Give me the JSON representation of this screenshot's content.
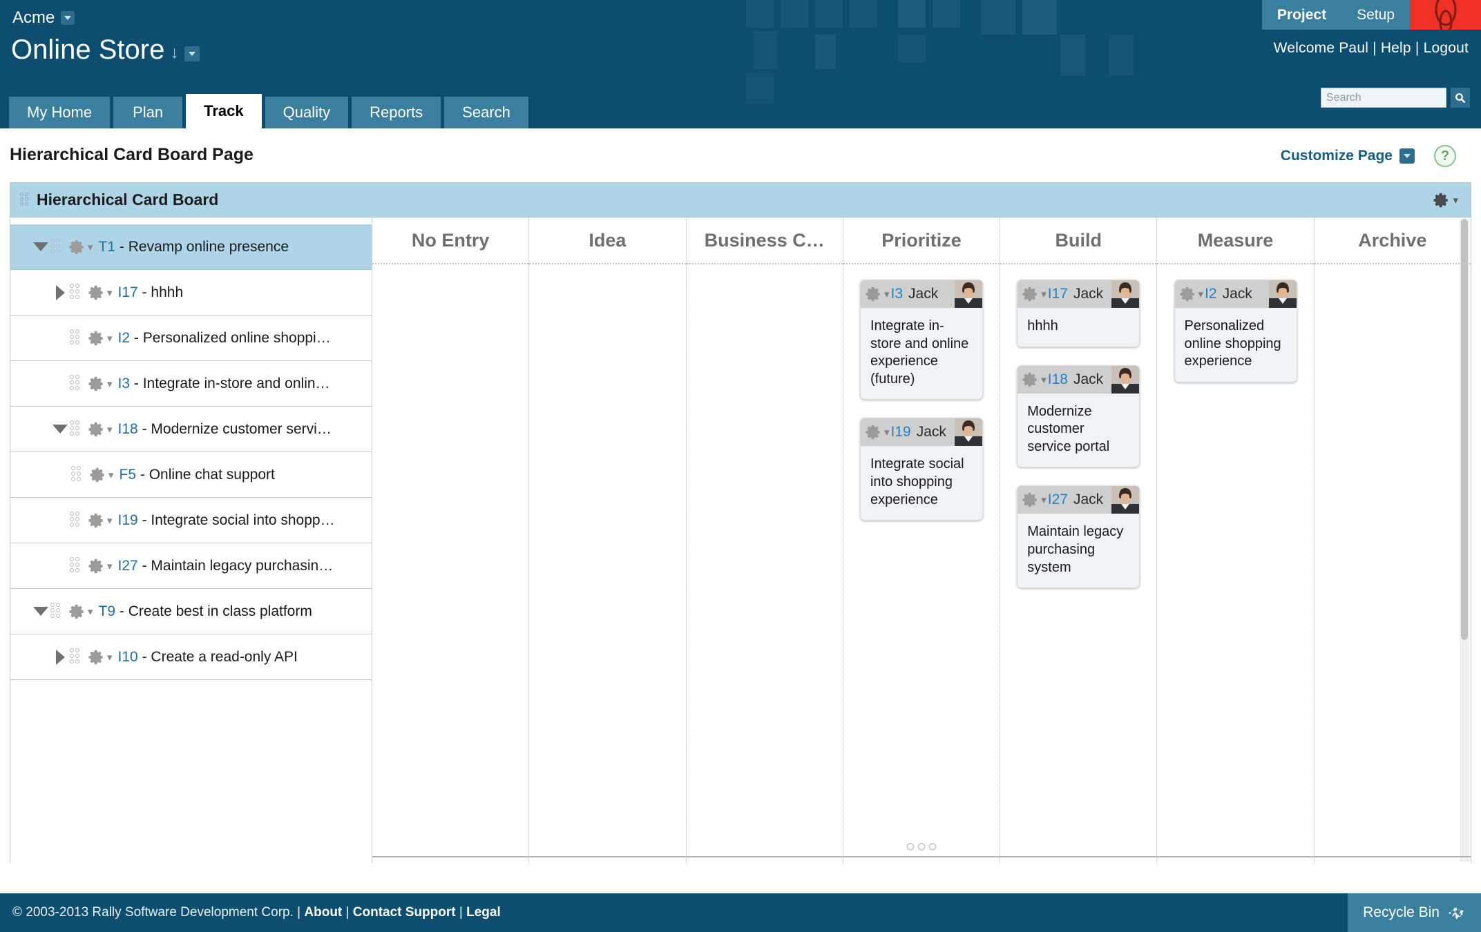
{
  "header": {
    "org": "Acme",
    "project": "Online Store",
    "project_sort_icon": "down-arrow-icon",
    "nav_right": [
      {
        "label": "Project",
        "active": true
      },
      {
        "label": "Setup",
        "active": false
      }
    ],
    "welcome": "Welcome Paul",
    "help_link": "Help",
    "logout_link": "Logout",
    "separator": "|",
    "search_placeholder": "Search",
    "search_value": "",
    "search_icon": "magnifier-icon",
    "tabs": [
      {
        "label": "My Home",
        "active": false
      },
      {
        "label": "Plan",
        "active": false
      },
      {
        "label": "Track",
        "active": true
      },
      {
        "label": "Quality",
        "active": false
      },
      {
        "label": "Reports",
        "active": false
      },
      {
        "label": "Search",
        "active": false
      }
    ]
  },
  "page": {
    "title": "Hierarchical Card Board Page",
    "customize_label": "Customize Page",
    "help_glyph": "?"
  },
  "panel": {
    "title": "Hierarchical Card Board",
    "gear_icon": "gear-icon"
  },
  "tree": {
    "items": [
      {
        "twisty": "open",
        "indent": 0,
        "id": "T1",
        "name": "Revamp online presence",
        "selected": true
      },
      {
        "twisty": "closed",
        "indent": 1,
        "id": "I17",
        "name": "hhhh",
        "selected": false
      },
      {
        "twisty": "none",
        "indent": 1,
        "id": "I2",
        "name": "Personalized online shoppi…",
        "selected": false
      },
      {
        "twisty": "none",
        "indent": 1,
        "id": "I3",
        "name": "Integrate in-store and onlin…",
        "selected": false
      },
      {
        "twisty": "open",
        "indent": 1,
        "id": "I18",
        "name": "Modernize customer servi…",
        "selected": false
      },
      {
        "twisty": "none",
        "indent": 2,
        "id": "F5",
        "name": "Online chat support",
        "selected": false
      },
      {
        "twisty": "none",
        "indent": 1,
        "id": "I19",
        "name": "Integrate social into shopp…",
        "selected": false
      },
      {
        "twisty": "none",
        "indent": 1,
        "id": "I27",
        "name": "Maintain legacy purchasin…",
        "selected": false
      },
      {
        "twisty": "open",
        "indent": 0,
        "id": "T9",
        "name": "Create best in class platform",
        "selected": false
      },
      {
        "twisty": "closed",
        "indent": 1,
        "id": "I10",
        "name": "Create a read-only API",
        "selected": false
      }
    ],
    "separator": " - "
  },
  "board": {
    "columns": [
      {
        "label": "No Entry",
        "cards": []
      },
      {
        "label": "Idea",
        "cards": []
      },
      {
        "label": "Business C…",
        "cards": []
      },
      {
        "label": "Prioritize",
        "cards": [
          {
            "id": "I3",
            "owner": "Jack",
            "text": "Integrate in-store and online experience (future)"
          },
          {
            "id": "I19",
            "owner": "Jack",
            "text": "Integrate social into shopping experience"
          }
        ]
      },
      {
        "label": "Build",
        "cards": [
          {
            "id": "I17",
            "owner": "Jack",
            "text": "hhhh"
          },
          {
            "id": "I18",
            "owner": "Jack",
            "text": "Modernize customer service portal"
          },
          {
            "id": "I27",
            "owner": "Jack",
            "text": "Maintain legacy purchasing system"
          }
        ]
      },
      {
        "label": "Measure",
        "cards": [
          {
            "id": "I2",
            "owner": "Jack",
            "text": "Personalized online shopping experience"
          }
        ]
      },
      {
        "label": "Archive",
        "cards": []
      }
    ]
  },
  "footer": {
    "copyright": "© 2003-2013 Rally Software Development Corp.",
    "links": [
      "About",
      "Contact Support",
      "Legal"
    ],
    "separator": "|",
    "recycle_label": "Recycle Bin",
    "recycle_icon": "recycle-icon"
  },
  "colors": {
    "header_bg": "#0d4e70",
    "tab_bg": "#3b7f9e",
    "accent_link": "#145d86",
    "panel_header": "#aed4e8",
    "logo_red": "#ee3124",
    "card_bg": "#eff3f5",
    "card_head": "#cfcfcf"
  }
}
